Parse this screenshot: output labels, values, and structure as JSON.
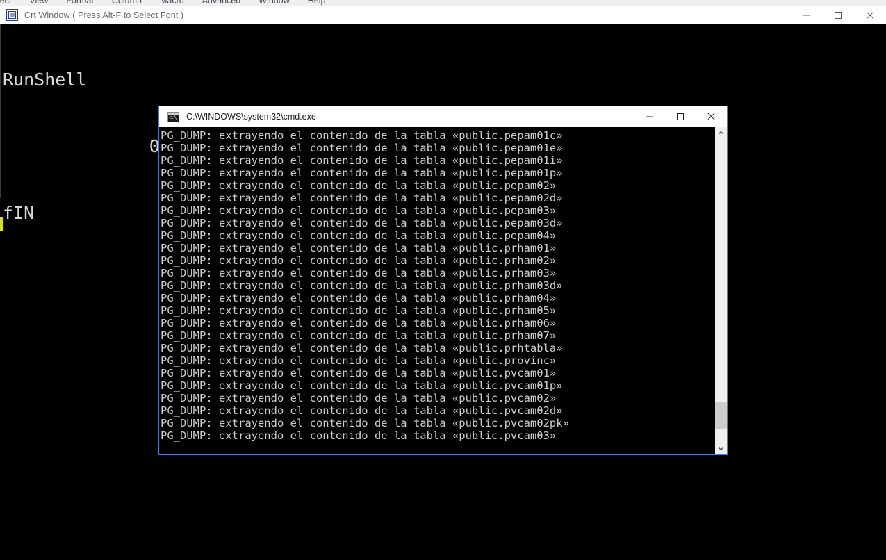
{
  "host_menubar": {
    "items": [
      "oject",
      "View",
      "Format",
      "Column",
      "Macro",
      "Advanced",
      "Window",
      "Help"
    ]
  },
  "crt_window": {
    "icon": "crt-app-icon",
    "title": "Crt Window ( Press Alt-F to Select Font )",
    "controls": {
      "minimize": "minimize-icon",
      "maximize": "maximize-icon",
      "close": "close-icon"
    },
    "console_lines": [
      "RunShell",
      "              0",
      "fIN"
    ],
    "left_marker_color": "#d8e019"
  },
  "cmd_window": {
    "icon": "cmd-console-icon",
    "title": "C:\\WINDOWS\\system32\\cmd.exe",
    "controls": {
      "minimize": "minimize-icon",
      "maximize": "maximize-icon",
      "close": "close-icon"
    },
    "scrollbar": {
      "up_arrow": "chevron-up-icon",
      "down_arrow": "chevron-down-icon",
      "thumb_top_pct": 86,
      "thumb_height_pct": 9
    },
    "prefix": "PG_DUMP: extrayendo el contenido de la tabla ",
    "lines": [
      "PG_DUMP: extrayendo el contenido de la tabla «public.pepam01c»",
      "PG_DUMP: extrayendo el contenido de la tabla «public.pepam01e»",
      "PG_DUMP: extrayendo el contenido de la tabla «public.pepam01i»",
      "PG_DUMP: extrayendo el contenido de la tabla «public.pepam01p»",
      "PG_DUMP: extrayendo el contenido de la tabla «public.pepam02»",
      "PG_DUMP: extrayendo el contenido de la tabla «public.pepam02d»",
      "PG_DUMP: extrayendo el contenido de la tabla «public.pepam03»",
      "PG_DUMP: extrayendo el contenido de la tabla «public.pepam03d»",
      "PG_DUMP: extrayendo el contenido de la tabla «public.pepam04»",
      "PG_DUMP: extrayendo el contenido de la tabla «public.prham01»",
      "PG_DUMP: extrayendo el contenido de la tabla «public.prham02»",
      "PG_DUMP: extrayendo el contenido de la tabla «public.prham03»",
      "PG_DUMP: extrayendo el contenido de la tabla «public.prham03d»",
      "PG_DUMP: extrayendo el contenido de la tabla «public.prham04»",
      "PG_DUMP: extrayendo el contenido de la tabla «public.prham05»",
      "PG_DUMP: extrayendo el contenido de la tabla «public.prham06»",
      "PG_DUMP: extrayendo el contenido de la tabla «public.prham07»",
      "PG_DUMP: extrayendo el contenido de la tabla «public.prhtabla»",
      "PG_DUMP: extrayendo el contenido de la tabla «public.provinc»",
      "PG_DUMP: extrayendo el contenido de la tabla «public.pvcam01»",
      "PG_DUMP: extrayendo el contenido de la tabla «public.pvcam01p»",
      "PG_DUMP: extrayendo el contenido de la tabla «public.pvcam02»",
      "PG_DUMP: extrayendo el contenido de la tabla «public.pvcam02d»",
      "PG_DUMP: extrayendo el contenido de la tabla «public.pvcam02pk»",
      "PG_DUMP: extrayendo el contenido de la tabla «public.pvcam03»"
    ]
  },
  "colors": {
    "cmd_border": "#4a7ebb",
    "console_bg": "#000000",
    "console_fg": "#cccccc",
    "scrollbar_track": "#f0f0f0",
    "scrollbar_thumb": "#cdcdcd"
  }
}
